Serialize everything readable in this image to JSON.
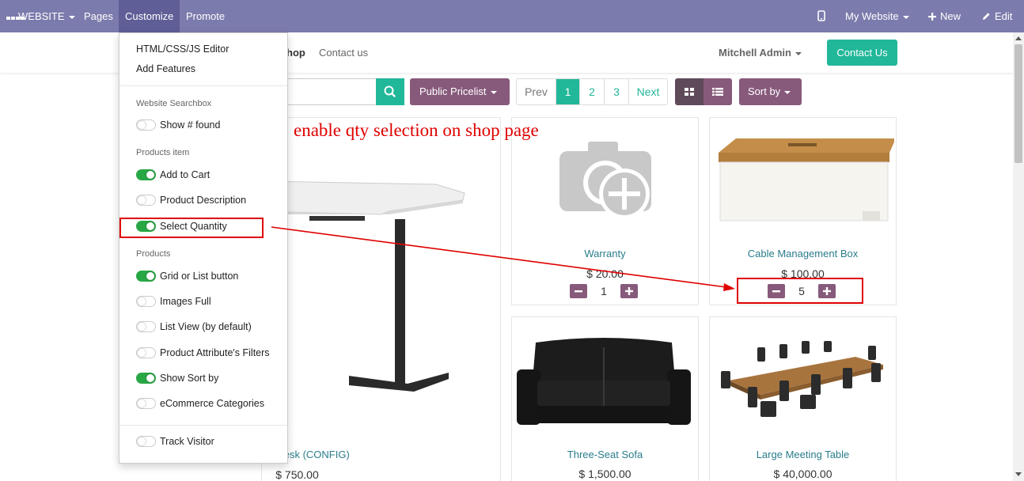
{
  "topbar": {
    "website_label": "WEBSITE",
    "pages_label": "Pages",
    "customize_label": "Customize",
    "promote_label": "Promote",
    "my_website_label": "My Website",
    "new_label": "New",
    "edit_label": "Edit"
  },
  "header": {
    "nav_shop": "hop",
    "nav_contact": "Contact us",
    "user_name": "Mitchell Admin",
    "contact_button": "Contact Us"
  },
  "toolbar": {
    "pricelist_label": "Public Pricelist",
    "pager": {
      "prev": "Prev",
      "pages": [
        "1",
        "2",
        "3"
      ],
      "current": "1",
      "next": "Next"
    },
    "sort_label": "Sort by"
  },
  "customize_menu": {
    "editor_link": "HTML/CSS/JS Editor",
    "features_link": "Add Features",
    "sections": [
      {
        "heading": "Website Searchbox",
        "options": [
          {
            "label": "Show # found",
            "enabled": false
          }
        ]
      },
      {
        "heading": "Products item",
        "options": [
          {
            "label": "Add to Cart",
            "enabled": true
          },
          {
            "label": "Product Description",
            "enabled": false
          },
          {
            "label": "Select Quantity",
            "enabled": true
          }
        ]
      },
      {
        "heading": "Products",
        "options": [
          {
            "label": "Grid or List button",
            "enabled": true
          },
          {
            "label": "Images Full",
            "enabled": false
          },
          {
            "label": "List View (by default)",
            "enabled": false
          },
          {
            "label": "Product Attribute's Filters",
            "enabled": false
          },
          {
            "label": "Show Sort by",
            "enabled": true
          },
          {
            "label": "eCommerce Categories",
            "enabled": false
          }
        ]
      }
    ],
    "track_visitor": {
      "label": "Track Visitor",
      "enabled": false
    }
  },
  "products": [
    {
      "name": "able Desk (CONFIG)",
      "price": "$ 750.00"
    },
    {
      "name": "Warranty",
      "price": "$ 20.00",
      "qty": "1"
    },
    {
      "name": "Cable Management Box",
      "price": "$ 100.00",
      "qty": "5"
    },
    {
      "name": "Three-Seat Sofa",
      "price": "$ 1,500.00"
    },
    {
      "name": "Large Meeting Table",
      "price": "$ 40,000.00"
    }
  ],
  "annotation": {
    "text": "enable qty selection on shop page",
    "color": "#e00000"
  },
  "colors": {
    "topbar": "#7c7bad",
    "accent": "#21b799",
    "plum": "#875a7b",
    "toggle_on": "#28a745"
  }
}
